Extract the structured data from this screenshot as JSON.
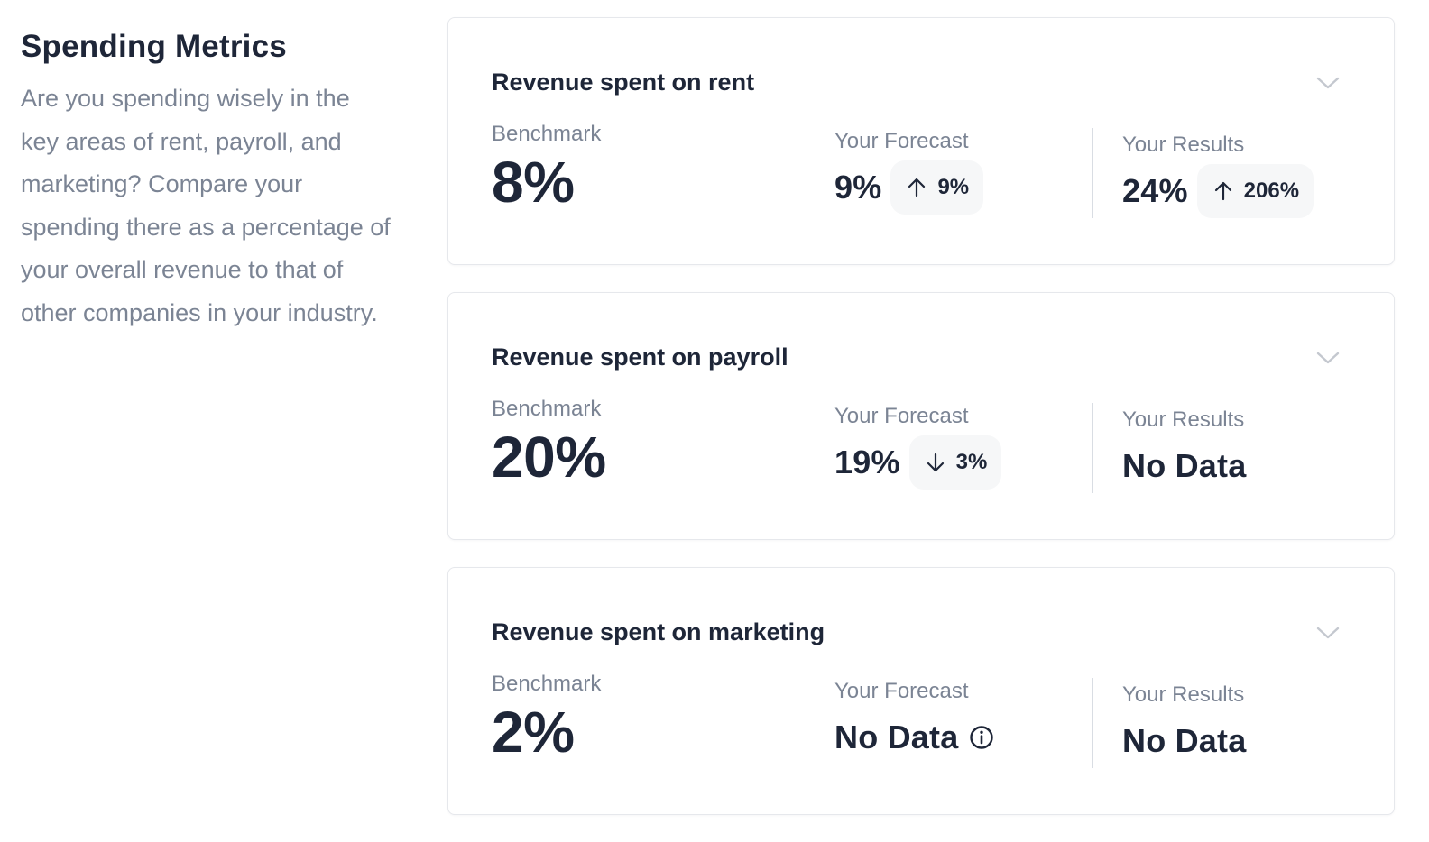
{
  "intro": {
    "title": "Spending Metrics",
    "description": "Are you spending wisely in the key areas of rent, payroll, and marketing? Compare your spending there as a percentage of your overall revenue to that of other companies in your industry."
  },
  "labels": {
    "benchmark": "Benchmark",
    "forecast": "Your Forecast",
    "results": "Your Results"
  },
  "cards": [
    {
      "title": "Revenue spent on rent",
      "benchmark": "8%",
      "forecast": {
        "value": "9%",
        "change": "9%",
        "direction": "up"
      },
      "results": {
        "value": "24%",
        "change": "206%",
        "direction": "up"
      }
    },
    {
      "title": "Revenue spent on payroll",
      "benchmark": "20%",
      "forecast": {
        "value": "19%",
        "change": "3%",
        "direction": "down"
      },
      "results": {
        "value": "No Data"
      }
    },
    {
      "title": "Revenue spent on marketing",
      "benchmark": "2%",
      "forecast": {
        "value": "No Data",
        "icon": "info-icon"
      },
      "results": {
        "value": "No Data"
      }
    }
  ],
  "colors": {
    "text_primary": "#1e2638",
    "text_muted": "#7b8494",
    "pill_bg": "#f6f7f8",
    "border": "#e6e8ec"
  }
}
